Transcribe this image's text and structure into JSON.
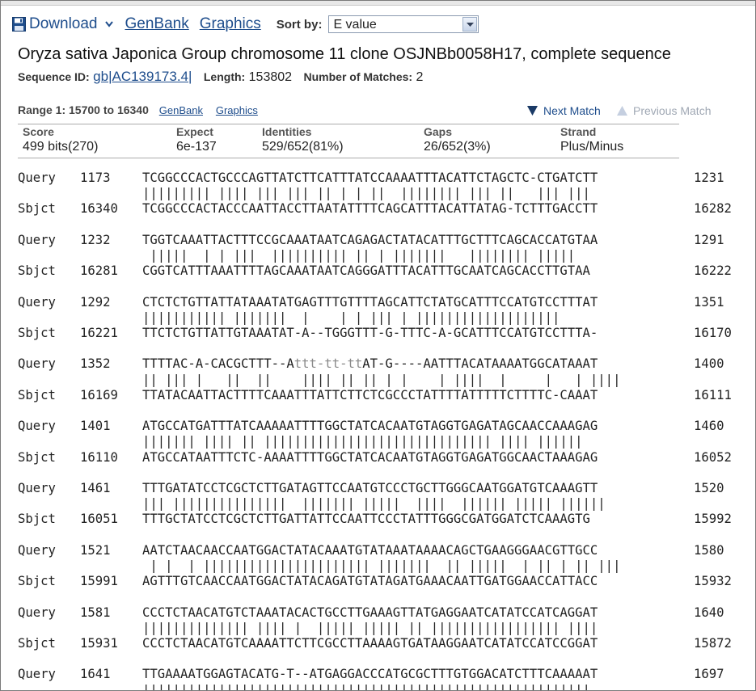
{
  "toolbar": {
    "download_label": "Download",
    "genbank_label": "GenBank",
    "graphics_label": "Graphics",
    "sort_label": "Sort by:",
    "sort_value": "E value"
  },
  "record": {
    "title": "Oryza sativa Japonica Group chromosome 11 clone OSJNBb0058H17, complete sequence",
    "seq_id_label": "Sequence ID:",
    "seq_id_value": "gb|AC139173.4|",
    "length_label": "Length:",
    "length_value": "153802",
    "matches_label": "Number of Matches:",
    "matches_value": "2"
  },
  "range": {
    "label": "Range 1: 15700 to 16340",
    "genbank_link": "GenBank",
    "graphics_link": "Graphics",
    "next_match": "Next Match",
    "previous_match": "Previous Match"
  },
  "stats": [
    {
      "header": "Score",
      "value": "499 bits(270)"
    },
    {
      "header": "Expect",
      "value": "6e-137"
    },
    {
      "header": "Identities",
      "value": "529/652(81%)"
    },
    {
      "header": "Gaps",
      "value": "26/652(3%)"
    },
    {
      "header": "Strand",
      "value": "Plus/Minus"
    }
  ],
  "alignment": [
    {
      "q_start": "1173",
      "q_seq": "TCGGCCCACTGCCCAGTTATCTTCATTTATCCAAAATTTACATTCTAGCTC-CTGATCTT",
      "q_end": "1231",
      "match": "||||||||| |||| ||| ||| || | | ||  |||||||| ||| ||   ||| |||",
      "s_start": "16340",
      "s_seq": "TCGGCCCACTACCCAATTACCTTAATATTTTCAGCATTTACATTATAG-TCTTTGACCTT",
      "s_end": "16282"
    },
    {
      "q_start": "1232",
      "q_seq": "TGGTCAAATTACTTTCCGCAAATAATCAGAGACTATACATTTGCTTTCAGCACCATGTAA",
      "q_end": "1291",
      "match": " |||||  | | |||  |||||||||| || | |||||||   |||||||| |||||",
      "s_start": "16281",
      "s_seq": "CGGTCATTTAAATTTTAGCAAATAATCAGGGATTTACATTTGCAATCAGCACCTTGTAA",
      "s_end": "16222"
    },
    {
      "q_start": "1292",
      "q_seq": "CTCTCTGTTATTATAAATATGAGTTTGTTTTAGCATTCTATGCATTTCCATGTCCTTTAT",
      "q_end": "1351",
      "match": "||||||||||| |||||||  |    | | ||| | |||||||||||||||||||",
      "s_start": "16221",
      "s_seq": "TTCTCTGTTATTGTAAATAT-A--TGGGTTT-G-TTTC-A-GCATTTCCATGTCCTTTA-",
      "s_end": "16170"
    },
    {
      "q_start": "1352",
      "q_seq": "TTTTAC-A-CACGCTTT--A",
      "q_seq_lc": "ttt-tt-tt",
      "q_seq_tail": "AT-G----AATTTACATAAAATGGCATAAAT",
      "q_end": "1400",
      "match": "|| ||| |   ||  ||    |||| || || | |    | ||||  |     |   | ||||",
      "s_start": "16169",
      "s_seq": "TTATACAATTACTTTTCAAATTTATTCTTCTCGCCCTATTTTATTTTTCTTTTC-CAAAT",
      "s_end": "16111"
    },
    {
      "q_start": "1401",
      "q_seq": "ATGCCATGATTTATCAAAAATTTTGGCTATCACAATGTAGGTGAGATAGCAACCAAAGAG",
      "q_end": "1460",
      "match": "||||||| |||| || |||||||||||||||||||||||||||||| |||| ||||||",
      "s_start": "16110",
      "s_seq": "ATGCCATAATTTCTC-AAAATTTTGGCTATCACAATGTAGGTGAGATGGCAACTAAAGAG",
      "s_end": "16052"
    },
    {
      "q_start": "1461",
      "q_seq": "TTTGATATCCTCGCTCTTGATAGTTCCAATGTCCCTGCTTGGGCAATGGATGTCAAAGTT",
      "q_end": "1520",
      "match": "||| |||||||||||||||  ||||||| |||||  ||||  |||||| ||||| ||||||",
      "s_start": "16051",
      "s_seq": "TTTGCTATCCTCGCTCTTGATTATTCCAATTCCCTATTTGGGCGATGGATCTCAAAGTG",
      "s_end": "15992"
    },
    {
      "q_start": "1521",
      "q_seq": "AATCTAACAACCAATGGACTATACAAATGTATAAATAAAACAGCTGAAGGGAACGTTGCC",
      "q_end": "1580",
      "match": " | |  | |||||||||||||||||||||| |||||||  || |||||  | || | || |||",
      "s_start": "15991",
      "s_seq": "AGTTTGTCAACCAATGGACTATACAGATGTATAGATGAAACAATTGATGGAACCATTACC",
      "s_end": "15932"
    },
    {
      "q_start": "1581",
      "q_seq": "CCCTCTAACATGTCTAAATACACTGCCTTGAAAGTTATGAGGAATCATATCCATCAGGAT",
      "q_end": "1640",
      "match": "|||||||||||||| |||| |  ||||| ||||| || ||||||||||||||||| ||||",
      "s_start": "15931",
      "s_seq": "CCCTCTAACATGTCAAAATTCTTCGCCTTAAAAGTGATAAGGAATCATATCCATCCGGAT",
      "s_end": "15872"
    },
    {
      "q_start": "1641",
      "q_seq": "TTGAAAATGGAGTACATG-T--ATGAGGACCCATGCGCTTTGTGGACATCTTTCAAAAAT",
      "q_end": "1697",
      "match": "|||||||||||||||||||||||||||||||||||||||||||||||||||||||||||",
      "s_start": "",
      "s_seq": "",
      "s_end": ""
    }
  ],
  "labels": {
    "query": "Query",
    "sbjct": "Sbjct"
  },
  "colors": {
    "link": "#1e4d8c",
    "next_arrow": "#1a3a66",
    "prev_arrow": "#c5cfe0"
  }
}
